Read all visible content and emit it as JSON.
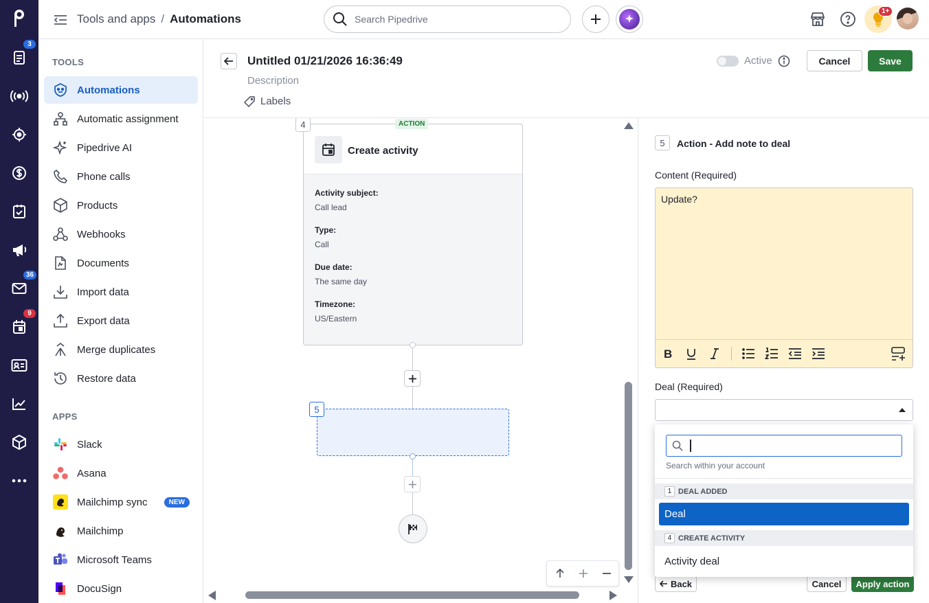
{
  "rail": {
    "badges": {
      "leads": "3",
      "mail": "36",
      "activities": "9"
    }
  },
  "topbar": {
    "breadcrumb_parent": "Tools and apps",
    "breadcrumb_sep": "/",
    "breadcrumb_current": "Automations",
    "search_placeholder": "Search Pipedrive",
    "notif_badge": "1+"
  },
  "sidebar": {
    "tools_title": "TOOLS",
    "tools": [
      {
        "label": "Automations"
      },
      {
        "label": "Automatic assignment"
      },
      {
        "label": "Pipedrive AI"
      },
      {
        "label": "Phone calls"
      },
      {
        "label": "Products"
      },
      {
        "label": "Webhooks"
      },
      {
        "label": "Documents"
      },
      {
        "label": "Import data"
      },
      {
        "label": "Export data"
      },
      {
        "label": "Merge duplicates"
      },
      {
        "label": "Restore data"
      }
    ],
    "apps_title": "APPS",
    "apps": [
      {
        "label": "Slack"
      },
      {
        "label": "Asana"
      },
      {
        "label": "Mailchimp sync",
        "badge": "NEW"
      },
      {
        "label": "Mailchimp"
      },
      {
        "label": "Microsoft Teams"
      },
      {
        "label": "DocuSign"
      }
    ]
  },
  "header": {
    "title": "Untitled 01/21/2026 16:36:49",
    "description": "Description",
    "labels": "Labels",
    "active_label": "Active",
    "cancel": "Cancel",
    "save": "Save"
  },
  "canvas": {
    "step4": {
      "num": "4",
      "tag": "ACTION",
      "title": "Create activity",
      "fields": [
        {
          "label": "Activity subject:",
          "value": "Call lead"
        },
        {
          "label": "Type:",
          "value": "Call"
        },
        {
          "label": "Due date:",
          "value": "The same day"
        },
        {
          "label": "Timezone:",
          "value": "US/Eastern"
        }
      ]
    },
    "step5_num": "5"
  },
  "panel": {
    "step_num": "5",
    "title": "Action - Add note to deal",
    "content_label": "Content (Required)",
    "content_value": "Update?",
    "deal_label": "Deal (Required)",
    "dropdown": {
      "search_hint": "Search within your account",
      "groups": [
        {
          "num": "1",
          "title": "DEAL ADDED",
          "options": [
            "Deal"
          ]
        },
        {
          "num": "4",
          "title": "CREATE ACTIVITY",
          "options": [
            "Activity deal"
          ]
        }
      ]
    },
    "back": "Back",
    "cancel": "Cancel",
    "apply": "Apply action"
  },
  "colors": {
    "rail": "#1f1d46",
    "accent": "#1a5fbe",
    "save_green": "#2d7a3d",
    "note_yellow": "#fff3cf",
    "selected_blue": "#0d63c6"
  }
}
